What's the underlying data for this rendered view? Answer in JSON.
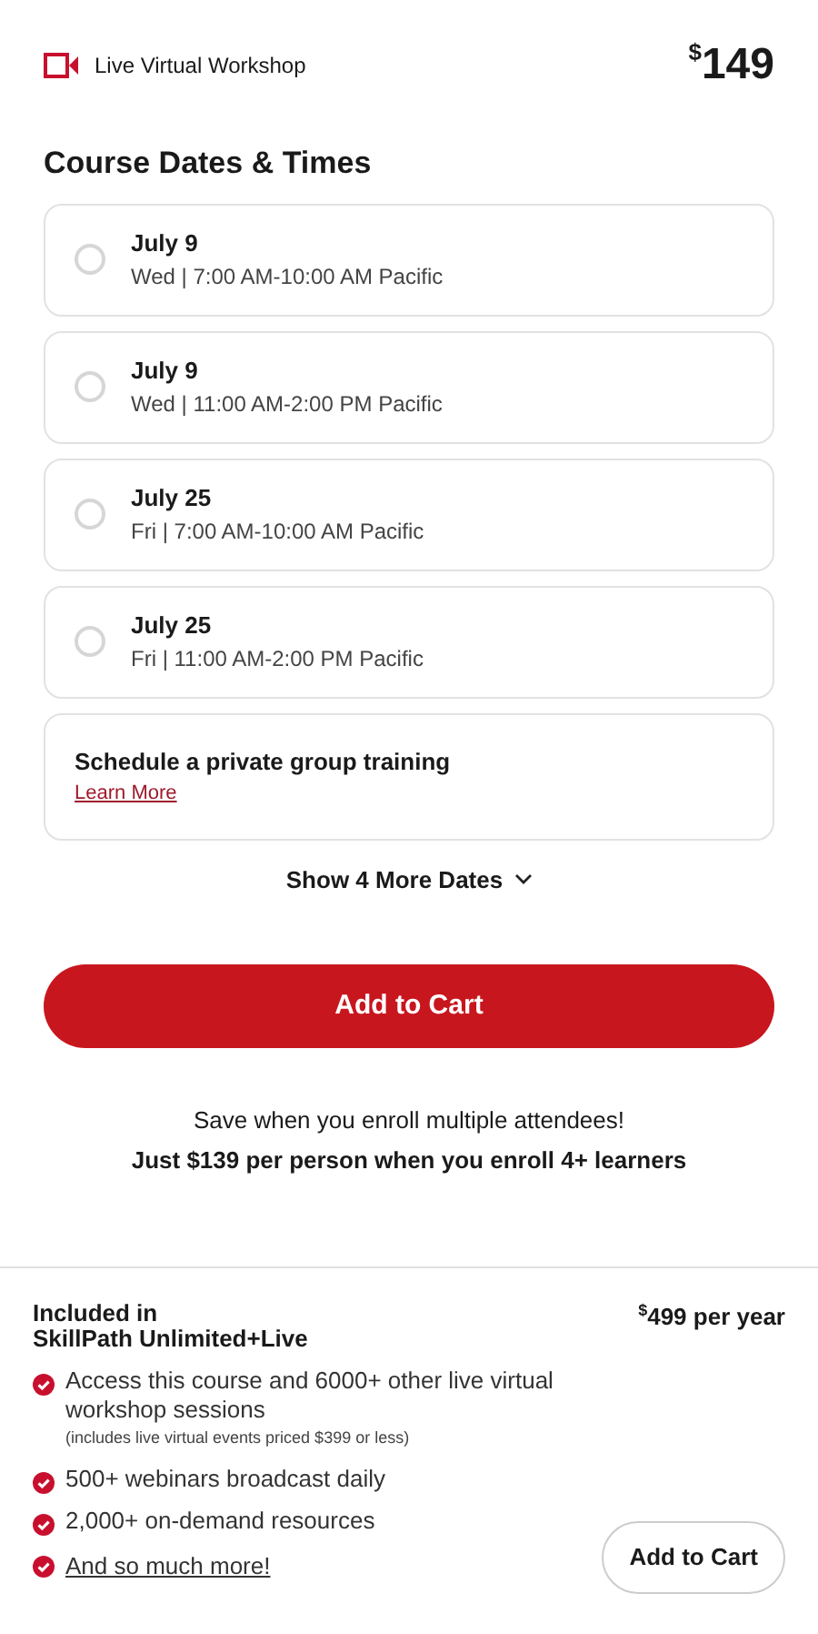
{
  "header": {
    "format": "Live Virtual Workshop",
    "price": {
      "currency": "$",
      "amount": "149"
    }
  },
  "dates_section": {
    "title": "Course Dates & Times",
    "options": [
      {
        "date": "July 9",
        "time": "Wed | 7:00 AM-10:00 AM Pacific",
        "selected": false
      },
      {
        "date": "July 9",
        "time": "Wed | 11:00 AM-2:00 PM Pacific",
        "selected": false
      },
      {
        "date": "July 25",
        "time": "Fri | 7:00 AM-10:00 AM Pacific",
        "selected": false
      },
      {
        "date": "July 25",
        "time": "Fri | 11:00 AM-2:00 PM Pacific",
        "selected": false
      }
    ],
    "private_training": {
      "title": "Schedule a private group training",
      "link": "Learn More"
    },
    "show_more": "Show 4 More Dates"
  },
  "add_to_cart": "Add to Cart",
  "promo": {
    "line": "Save when you enroll multiple attendees!",
    "bold_line": "Just $139 per person when you enroll 4+ learners"
  },
  "subscription": {
    "title_lines": [
      "Included in",
      "SkillPath Unlimited+Live"
    ],
    "price": {
      "currency": "$",
      "amount": "499 per year"
    },
    "features": [
      {
        "kind": "text",
        "text": "Access this course and 6000+ other live virtual workshop sessions",
        "note": "(includes live virtual events priced $399 or less)"
      },
      {
        "kind": "text",
        "text": "500+ webinars broadcast daily"
      },
      {
        "kind": "text",
        "text": "2,000+ on-demand resources"
      },
      {
        "kind": "link",
        "text": "And so much more!"
      }
    ],
    "button": "Add to Cart"
  }
}
